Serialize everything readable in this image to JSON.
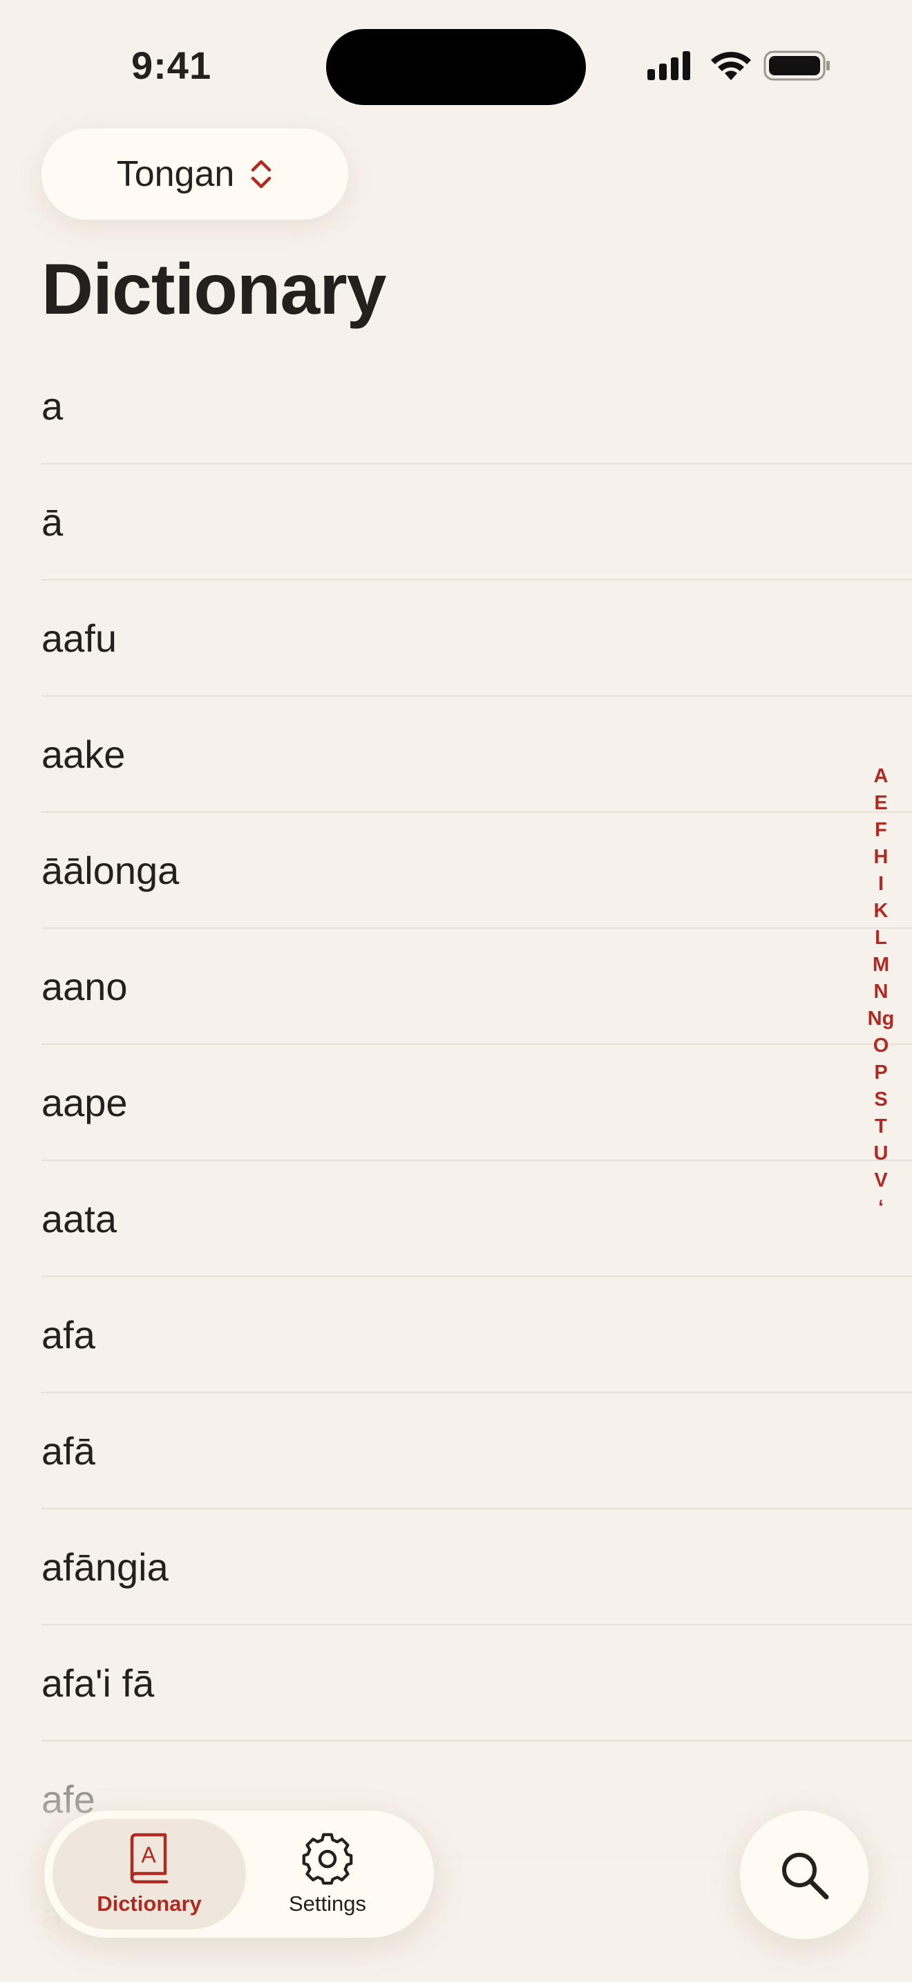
{
  "status_bar": {
    "time": "9:41"
  },
  "language_picker": {
    "label": "Tongan",
    "icon": "chevron-up-down-icon"
  },
  "page": {
    "title": "Dictionary"
  },
  "words": [
    "a",
    "ā",
    "aafu",
    "aake",
    "āālonga",
    "aano",
    "aape",
    "aata",
    "afa",
    "afā",
    "afāngia",
    "afa'i fā",
    "afe",
    "a"
  ],
  "index_letters": [
    "A",
    "E",
    "F",
    "H",
    "I",
    "K",
    "L",
    "M",
    "N",
    "Ng",
    "O",
    "P",
    "S",
    "T",
    "U",
    "V",
    "ʻ"
  ],
  "tabs": [
    {
      "label": "Dictionary",
      "icon": "dictionary-book-icon",
      "selected": true
    },
    {
      "label": "Settings",
      "icon": "gear-icon",
      "selected": false
    }
  ],
  "search": {
    "icon": "search-icon"
  },
  "colors": {
    "background": "#F6F1EA",
    "surface": "#FFFBF2",
    "accent": "#B02A24",
    "text": "#23201D"
  }
}
